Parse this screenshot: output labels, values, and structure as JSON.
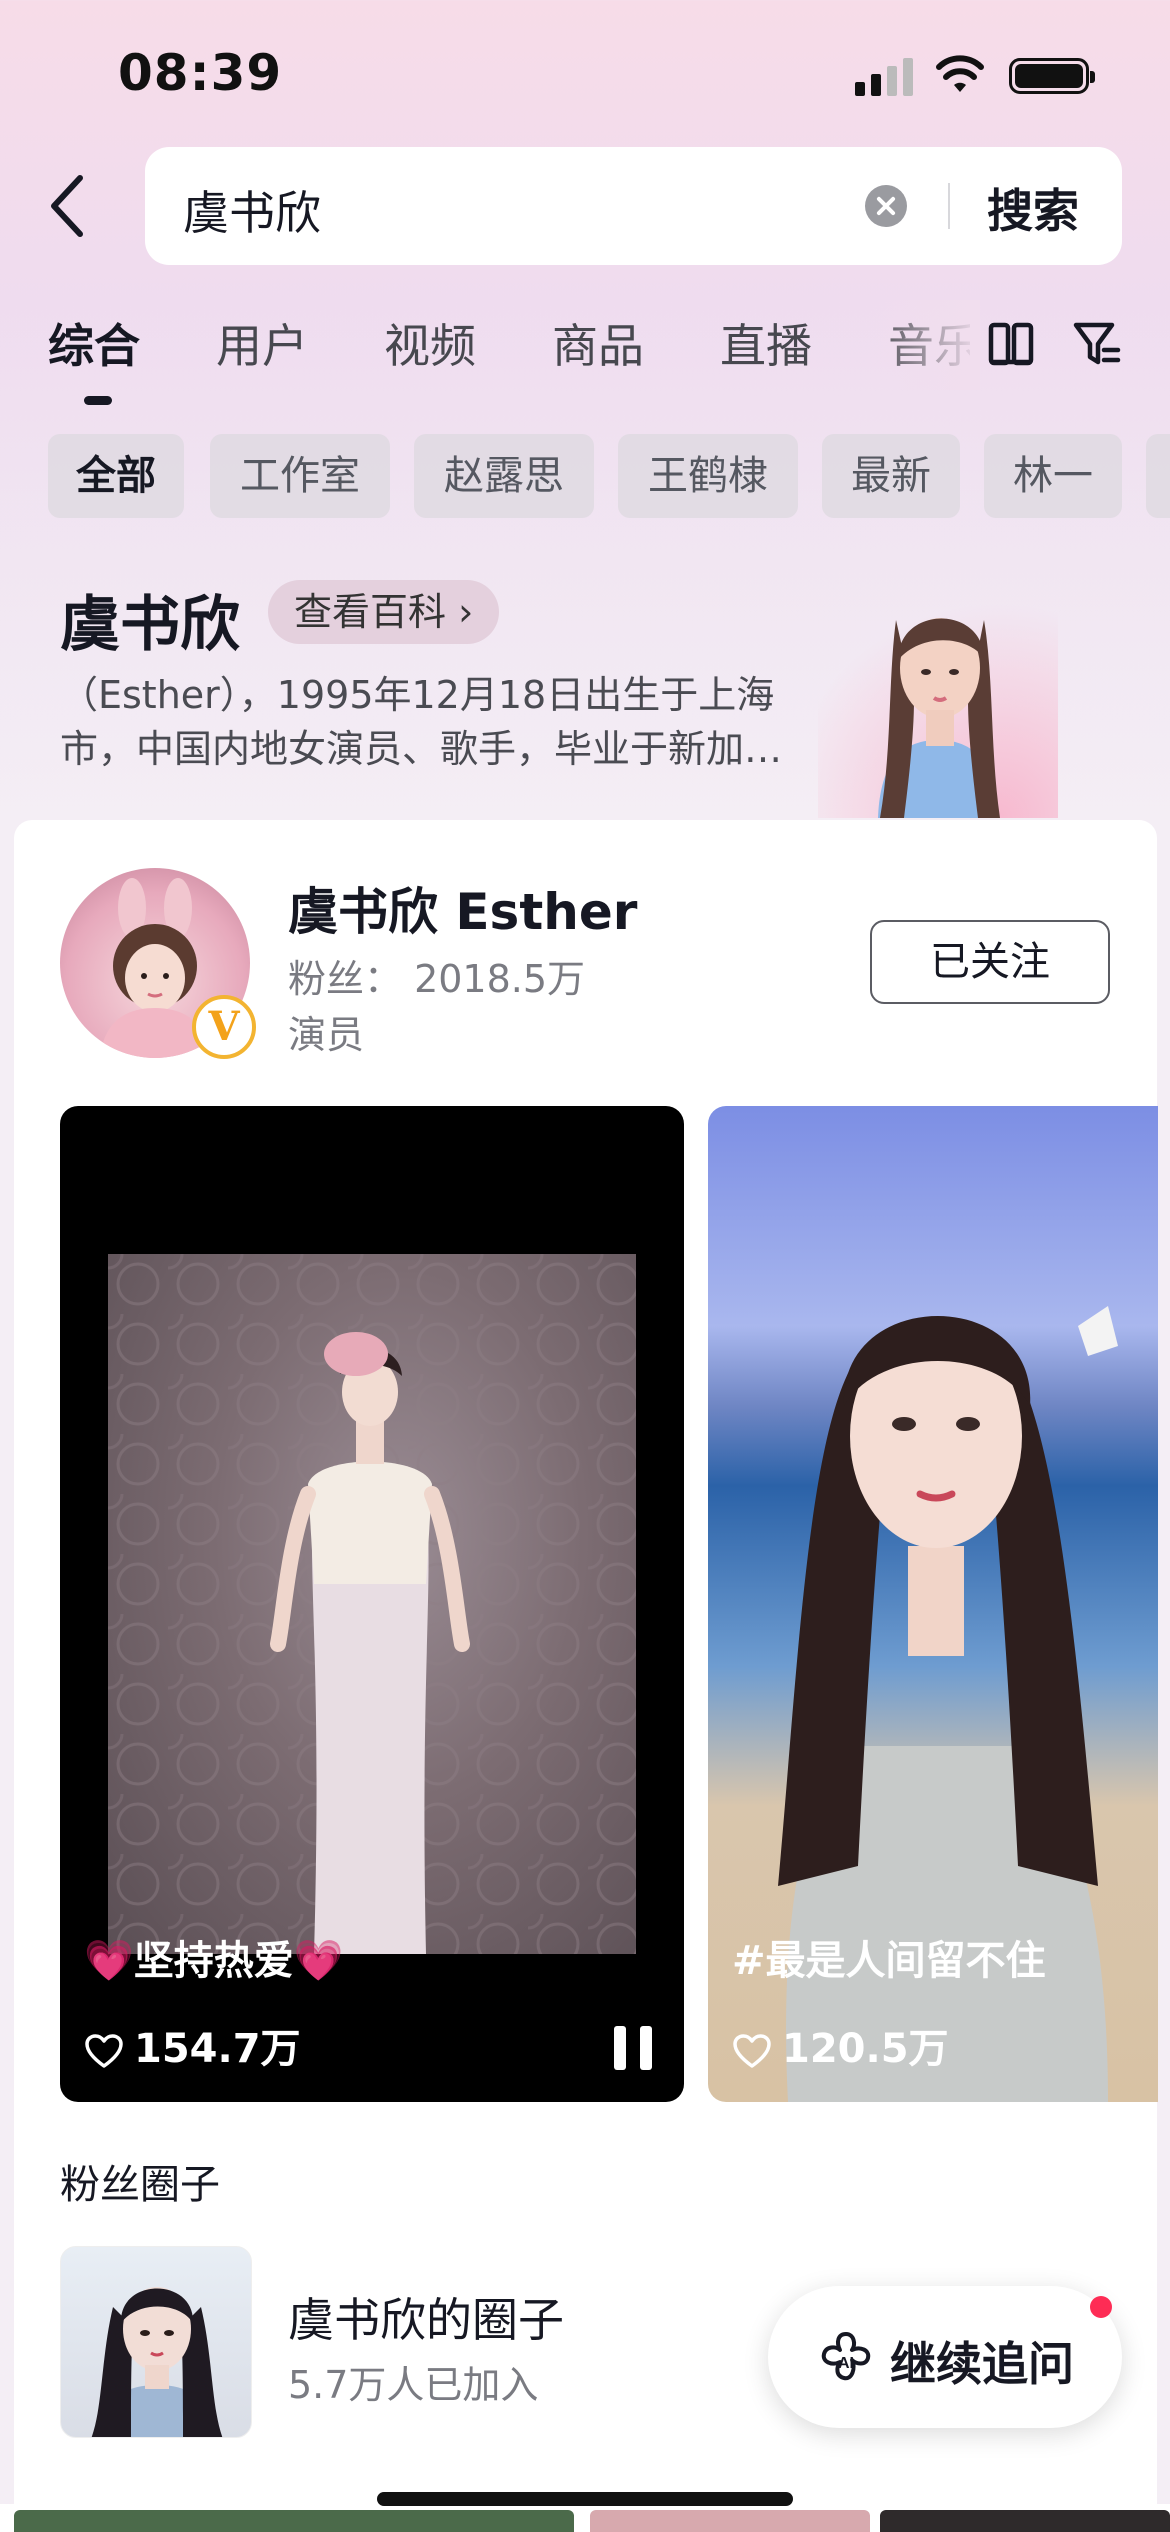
{
  "status_bar": {
    "time": "08:39"
  },
  "search": {
    "value": "虞书欣",
    "submit_label": "搜索"
  },
  "tabs": [
    {
      "label": "综合",
      "active": true
    },
    {
      "label": "用户"
    },
    {
      "label": "视频"
    },
    {
      "label": "商品"
    },
    {
      "label": "直播"
    },
    {
      "label": "音乐"
    }
  ],
  "chips": [
    {
      "label": "全部",
      "active": true
    },
    {
      "label": "工作室"
    },
    {
      "label": "赵露思"
    },
    {
      "label": "王鹤棣"
    },
    {
      "label": "最新"
    },
    {
      "label": "林一"
    }
  ],
  "encyclopedia": {
    "name": "虞书欣",
    "link_label": "查看百科 ›",
    "description": "（Esther），1995年12月18日出生于上海市，中国内地女演员、歌手，毕业于新加…"
  },
  "user_card": {
    "name": "虞书欣 Esther",
    "fans": "粉丝：  2018.5万",
    "role": "演员",
    "verified_badge": "V",
    "follow_label": "已关注"
  },
  "videos": [
    {
      "caption": "💗坚持热爱💗",
      "likes": "154.7万",
      "playing": true
    },
    {
      "caption": "#最是人间留不住",
      "likes": "120.5万"
    }
  ],
  "fan_circle": {
    "section_title": "粉丝圈子",
    "name": "虞书欣的圈子",
    "members": "5.7万人已加入"
  },
  "ai_button": {
    "label": "继续追问",
    "icon": "ai-flower-icon",
    "badge_color": "#fe2c55"
  },
  "colors": {
    "accent": "#fe2c55",
    "text_primary": "#161823",
    "text_secondary": "#7a7b82"
  }
}
